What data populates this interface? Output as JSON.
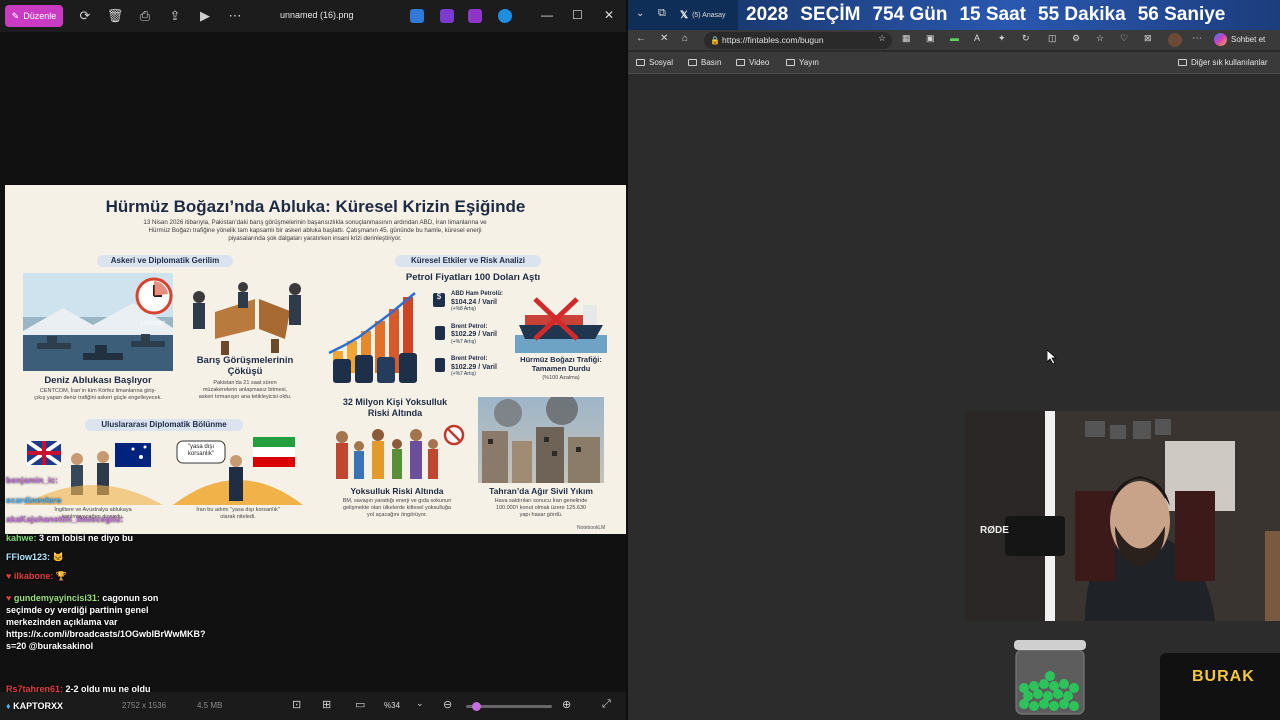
{
  "viewer": {
    "edit_label": "Düzenle",
    "file_title": "unnamed (16).png",
    "bottom": {
      "dimensions": "2752 x 1536",
      "size": "4.5 MB",
      "zoom": "%34"
    }
  },
  "infographic": {
    "title": "Hürmüz Boğazı’nda Abluka: Küresel Krizin Eşiğinde",
    "subtitle_1": "13 Nisan 2026 itibarıyla, Pakistan’daki barış görüşmelerinin başarısızlıkla sonuçlanmasının ardından ABD, İran limanlarına ve",
    "subtitle_2": "Hürmüz Boğazı trafiğine yönelik tam kapsamlı bir askeri abluka başlattı. Çatışmanın 45. gününde bu hamle, küresel enerji",
    "subtitle_3": "piyasalarında şok dalgaları yaratırken insani krizi derinleştiriyor.",
    "left_header": "Askeri ve Diplomatik Gerilim",
    "right_header": "Küresel Etkiler ve Risk Analizi",
    "clock_time": "14:00 GMT",
    "blockade_title": "Deniz Ablukası Başlıyor",
    "blockade_text_1": "CENTCOM, İran’ın tüm Körfez limanlarına giriş-",
    "blockade_text_2": "çıkış yapan deniz trafiğini askeri güçle engelleyecek.",
    "talks_title_1": "Barış Görüşmelerinin",
    "talks_title_2": "Çöküşü",
    "talks_text_1": "Pakistan’da 21 saat süren",
    "talks_text_2": "müzakerelerin anlaşmasız bitmesi,",
    "talks_text_3": "askeri tırmanışın ana tetikleyicisi oldu.",
    "oil_title": "Petrol Fiyatları 100 Doları Aştı",
    "oil_1_name": "ABD Ham Petrolü:",
    "oil_1_price": "$104.24 / Varil",
    "oil_1_change": "(+%8 Artış)",
    "oil_2_name": "Brent Petrol:",
    "oil_2_price": "$102.29 / Varil",
    "oil_2_change": "(+%7 Artış)",
    "oil_3_name": "Brent Petrol:",
    "oil_3_price": "$102.29 / Varil",
    "oil_3_change": "(+%7 Artış)",
    "traffic_title_1": "Hürmüz Boğazı Trafiği:",
    "traffic_title_2": "Tamamen Durdu",
    "traffic_sub": "(%100 Azalma)",
    "diplo_header": "Uluslararası Diplomatik Bölünme",
    "diplo_left_1": "İngiltere ve Avustralya ablukaya",
    "diplo_left_2": "katılmayacağını duyurdu.",
    "diplo_bubble_1": "\"yasa dışı",
    "diplo_bubble_2": "korsanlık\"",
    "diplo_right_1": "İran bu adımı \"yasa dışı korsanlık\"",
    "diplo_right_2": "olarak niteledi.",
    "poverty_head_1": "32 Milyon Kişi Yoksulluk",
    "poverty_head_2": "Riski Altında",
    "poverty_title": "Yoksulluk Riski Altında",
    "poverty_text_1": "BM, savaşın yarattığı enerji ve gıda sokunun",
    "poverty_text_2": "gelişmekte olan ülkelerde kitlesel yoksulluğa",
    "poverty_text_3": "yol açacağını öngörüyor.",
    "civil_title": "Tahran’da Ağır Sivil Yıkım",
    "civil_text_1": "Hava saldırıları sonucu İran genelinde",
    "civil_text_2": "100.000’i konut olmak üzere 125.630",
    "civil_text_3": "yapı hasar gördü.",
    "notebook_mark": "NotebookLM"
  },
  "chat": [
    {
      "user": "benjamin_ic:",
      "text": ""
    },
    {
      "user": "ecardinevlero",
      "text": ""
    },
    {
      "user": "akaKajuhanettin_ilmiecegilu:",
      "text": ""
    },
    {
      "user": "kahwe:",
      "text": "3 cm lobisi ne diyo bu"
    },
    {
      "user": "FFlow123:",
      "text": ""
    },
    {
      "user": "ilkabone:",
      "text": ""
    },
    {
      "user": "gundemyayincisi31:",
      "text": "cagonun son seçimde oy verdiği partinin genel merkezinden açıklama var https://x.com/i/broadcasts/1OGwblBrWwMKB?s=20 @buraksakinol"
    },
    {
      "user": "Rs7tahren61:",
      "text": "2-2 oldu mu ne oldu"
    },
    {
      "user": "KAPTORXX",
      "text": ""
    }
  ],
  "browser": {
    "tab_label": "(5) Anasay",
    "countdown": [
      "2028",
      "SEÇİM",
      "754 Gün",
      "15 Saat",
      "55 Dakika",
      "56 Saniye"
    ],
    "url": "https://fintables.com/bugun",
    "chat_label": "Sohbet et",
    "bookmarks": [
      "Sosyal",
      "Basın",
      "Video",
      "Yayın"
    ],
    "other_bookmarks": "Diğer sık kullanılanlar"
  },
  "overlay": {
    "mic_brand": "RØDE",
    "streamer_logo": "BURAK"
  },
  "colors": {
    "edit_button": "#c93bc2",
    "countdown_bar": "#2a58b0",
    "infographic_bg": "#f6f1e6",
    "logo_text": "#f5c73a"
  }
}
